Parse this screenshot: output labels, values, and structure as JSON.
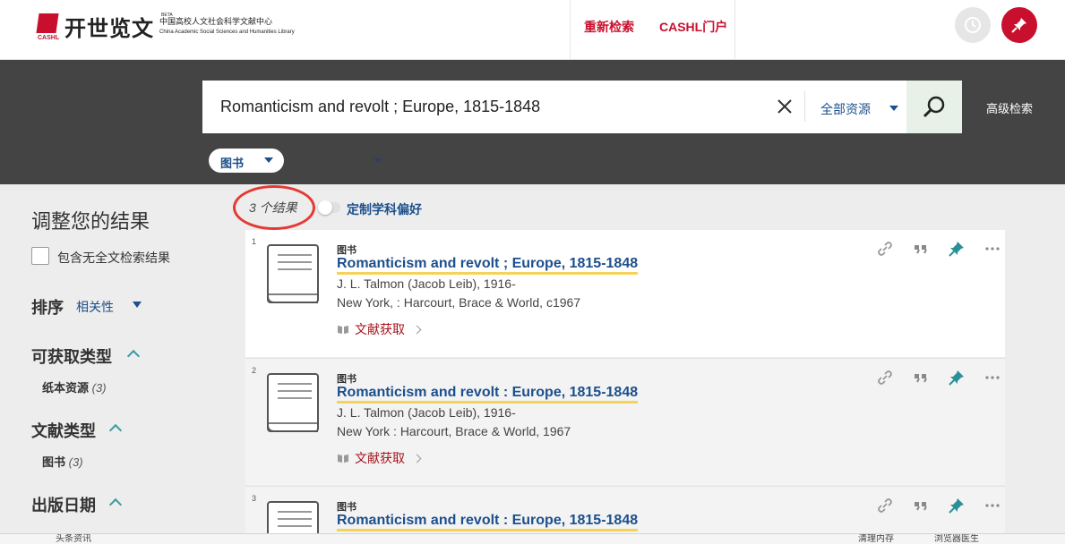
{
  "header": {
    "logo_cn": "开世览文",
    "logo_caption": "CASHL",
    "logo_beta": "BETA",
    "logo_sub_cn": "中国高校人文社会科学文献中心",
    "logo_sub_en": "China Academic Social Sciences and Humanities Library",
    "nav": [
      "重新检索",
      "CASHL门户"
    ],
    "brand_color": "#c8102e"
  },
  "search": {
    "query": "Romanticism and revolt ; Europe, 1815-1848",
    "resource_scope": "全部资源",
    "advanced_label": "高级检索",
    "type_filter": "图书"
  },
  "sidebar": {
    "title": "调整您的结果",
    "fulltext_checkbox_label": "包含无全文检索结果",
    "sort_label": "排序",
    "sort_value": "相关性",
    "sections": [
      {
        "title": "可获取类型",
        "items": [
          {
            "label": "纸本资源",
            "count": "(3)"
          }
        ]
      },
      {
        "title": "文献类型",
        "items": [
          {
            "label": "图书",
            "count": "(3)"
          }
        ]
      },
      {
        "title": "出版日期",
        "items": []
      }
    ]
  },
  "results": {
    "count_text": "3 个结果",
    "preference_toggle_label": "定制学科偏好",
    "items": [
      {
        "num": "1",
        "type": "图书",
        "title": "Romanticism and revolt ; Europe, 1815-1848",
        "author": "J. L. Talmon (Jacob Leib), 1916-",
        "publisher": "New York, : Harcourt, Brace & World, c1967",
        "get_label": "文献获取"
      },
      {
        "num": "2",
        "type": "图书",
        "title": "Romanticism and revolt : Europe, 1815-1848",
        "author": "J. L. Talmon (Jacob Leib), 1916-",
        "publisher": "New York : Harcourt, Brace & World, 1967",
        "get_label": "文献获取"
      },
      {
        "num": "3",
        "type": "图书",
        "title": "Romanticism and revolt : Europe, 1815-1848",
        "author": "",
        "publisher": "",
        "get_label": ""
      }
    ]
  },
  "statusbar": {
    "left": "头条资讯",
    "right1": "清理内存",
    "right2": "浏览器医生"
  }
}
